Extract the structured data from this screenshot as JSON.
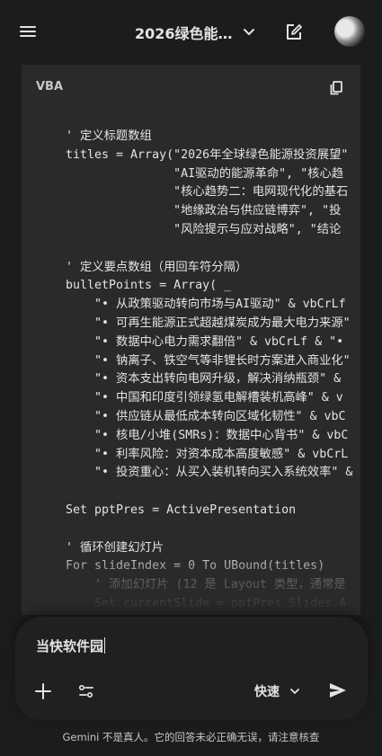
{
  "header": {
    "title": "2026绿色能…",
    "icons": {
      "menu": "menu-icon",
      "dropdown": "chevron-down-icon",
      "new_chat": "edit-icon",
      "avatar": "avatar"
    }
  },
  "code_block": {
    "language": "VBA",
    "copy_icon": "copy-icon",
    "lines": [
      "' 定义标题数组",
      "titles = Array(\"2026年全球绿色能源投资展望\"",
      "               \"AI驱动的能源革命\", \"核心趋",
      "               \"核心趋势二：电网现代化的基石",
      "               \"地缘政治与供应链博弈\", \"投",
      "               \"风险提示与应对战略\", \"结论",
      "",
      "' 定义要点数组（用回车符分隔）",
      "bulletPoints = Array( _",
      "    \"• 从政策驱动转向市场与AI驱动\" & vbCrLf",
      "    \"• 可再生能源正式超越煤炭成为最大电力来源\"",
      "    \"• 数据中心电力需求翻倍\" & vbCrLf & \"•",
      "    \"• 钠离子、铁空气等非锂长时方案进入商业化\"",
      "    \"• 资本支出转向电网升级，解决消纳瓶颈\" &",
      "    \"• 中国和印度引领绿氢电解槽装机高峰\" & v",
      "    \"• 供应链从最低成本转向区域化韧性\" & vbC",
      "    \"• 核电/小堆(SMRs)：数据中心背书\" & vbC",
      "    \"• 利率风险：对资本成本高度敏感\" & vbCrL",
      "    \"• 投资重心：从买入装机转向买入系统效率\" &",
      "",
      "Set pptPres = ActivePresentation",
      "",
      "' 循环创建幻灯片",
      "For slideIndex = 0 To UBound(titles)",
      "    ' 添加幻灯片 (12 是 Layout 类型，通常是",
      "    Set currentSlide = pptPres.Slides.A"
    ]
  },
  "composer": {
    "input_value": "当快软件园",
    "mode_label": "快速",
    "icons": {
      "add": "plus-icon",
      "tools": "tools-icon",
      "mode": "chevron-down-icon",
      "send": "send-icon"
    }
  },
  "disclaimer": "Gemini 不是真人。它的回答未必正确无误，请注意核查",
  "colors": {
    "background": "#1b1c1d",
    "code_background": "#282a2c",
    "composer_background": "#1f2021",
    "text": "#e3e3e3"
  }
}
